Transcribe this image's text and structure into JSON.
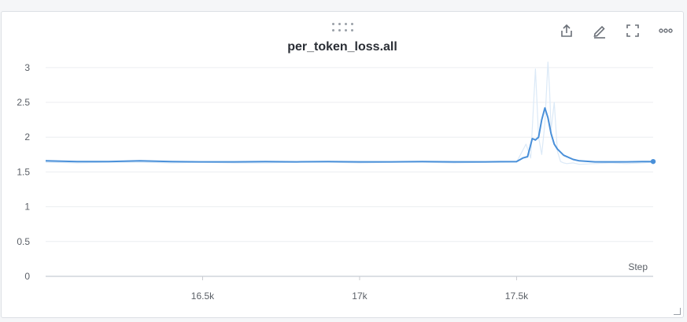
{
  "panel": {
    "title": "per_token_loss.all",
    "toolbar": [
      {
        "name": "export-icon"
      },
      {
        "name": "edit-icon"
      },
      {
        "name": "fullscreen-icon"
      },
      {
        "name": "more-icon"
      }
    ]
  },
  "chart_data": {
    "type": "line",
    "title": "per_token_loss.all",
    "xlabel": "Step",
    "ylabel": "",
    "xlim": [
      16000,
      17935
    ],
    "ylim": [
      0,
      3.1
    ],
    "xticks": [
      16500,
      17000,
      17500
    ],
    "xtick_labels": [
      "16.5k",
      "17k",
      "17.5k"
    ],
    "yticks": [
      0,
      0.5,
      1,
      1.5,
      2,
      2.5,
      3
    ],
    "ytick_labels": [
      "0",
      "0.5",
      "1",
      "1.5",
      "2",
      "2.5",
      "3"
    ],
    "grid": true,
    "colors": {
      "smoothed": "#4a90d9",
      "raw": "#dbe9f7"
    },
    "series": [
      {
        "role": "raw",
        "x": [
          16000,
          16100,
          16200,
          16300,
          16400,
          16500,
          16600,
          16700,
          16800,
          16900,
          17000,
          17100,
          17200,
          17300,
          17400,
          17500,
          17530,
          17545,
          17560,
          17570,
          17580,
          17590,
          17600,
          17605,
          17610,
          17620,
          17630,
          17640,
          17650,
          17660,
          17680,
          17700,
          17750,
          17800,
          17850,
          17900,
          17935
        ],
        "y": [
          1.64,
          1.63,
          1.64,
          1.64,
          1.63,
          1.64,
          1.63,
          1.63,
          1.64,
          1.64,
          1.63,
          1.64,
          1.64,
          1.63,
          1.64,
          1.64,
          1.9,
          1.7,
          2.98,
          2.0,
          1.75,
          2.2,
          3.08,
          2.7,
          2.1,
          2.5,
          1.8,
          1.65,
          1.63,
          1.62,
          1.63,
          1.61,
          1.62,
          1.63,
          1.62,
          1.63,
          1.64
        ]
      },
      {
        "role": "smoothed",
        "x": [
          16000,
          16100,
          16200,
          16300,
          16400,
          16500,
          16600,
          16700,
          16800,
          16900,
          17000,
          17100,
          17200,
          17300,
          17400,
          17500,
          17520,
          17535,
          17550,
          17560,
          17570,
          17580,
          17590,
          17600,
          17610,
          17620,
          17630,
          17650,
          17680,
          17700,
          17750,
          17800,
          17850,
          17900,
          17935
        ],
        "y": [
          1.66,
          1.65,
          1.65,
          1.66,
          1.65,
          1.645,
          1.645,
          1.65,
          1.645,
          1.65,
          1.645,
          1.645,
          1.65,
          1.645,
          1.645,
          1.65,
          1.7,
          1.72,
          1.98,
          1.96,
          2.0,
          2.25,
          2.42,
          2.28,
          2.05,
          1.9,
          1.83,
          1.74,
          1.68,
          1.66,
          1.645,
          1.645,
          1.645,
          1.65,
          1.65
        ]
      }
    ]
  }
}
